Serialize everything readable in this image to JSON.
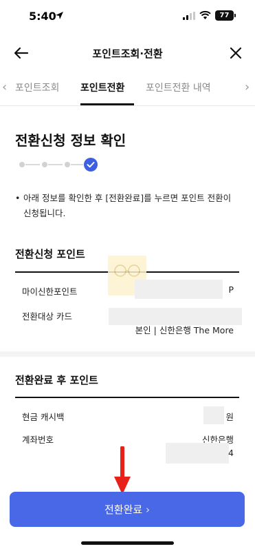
{
  "status_bar": {
    "time": "5:40",
    "battery": "77",
    "icons": [
      "location-arrow-icon",
      "signal-icon",
      "wifi-icon",
      "battery-icon"
    ]
  },
  "header": {
    "title": "포인트조회·전환",
    "back_icon": "back-arrow-icon",
    "close_icon": "close-icon"
  },
  "tabs": {
    "items": [
      {
        "label": "포인트조회",
        "active": false
      },
      {
        "label": "포인트전환",
        "active": true
      },
      {
        "label": "포인트전환 내역",
        "active": false
      }
    ]
  },
  "page": {
    "title": "전환신청 정보 확인",
    "stepper": {
      "total_steps": 4,
      "current_step": 4
    },
    "notice_bullet": "•",
    "notice": "아래 정보를 확인한 후 [전환완료]를 누르면 포인트 전환이 신청됩니다."
  },
  "section_apply": {
    "title": "전환신청 포인트",
    "rows": [
      {
        "label": "마이신한포인트",
        "value": "P"
      },
      {
        "label": "전환대상 카드",
        "value": "본인 | 신한은행 The More"
      }
    ]
  },
  "section_after": {
    "title": "전환완료 후 포인트",
    "rows": [
      {
        "label": "현금 캐시백",
        "value": "원"
      },
      {
        "label": "계좌번호",
        "value": "신한은행",
        "value_suffix": "4"
      }
    ]
  },
  "action": {
    "complete_label": "전환완료",
    "chevron": "›"
  },
  "colors": {
    "accent": "#4868e8",
    "step_active": "#3d5fe0",
    "annotation_arrow": "#e8201a"
  }
}
